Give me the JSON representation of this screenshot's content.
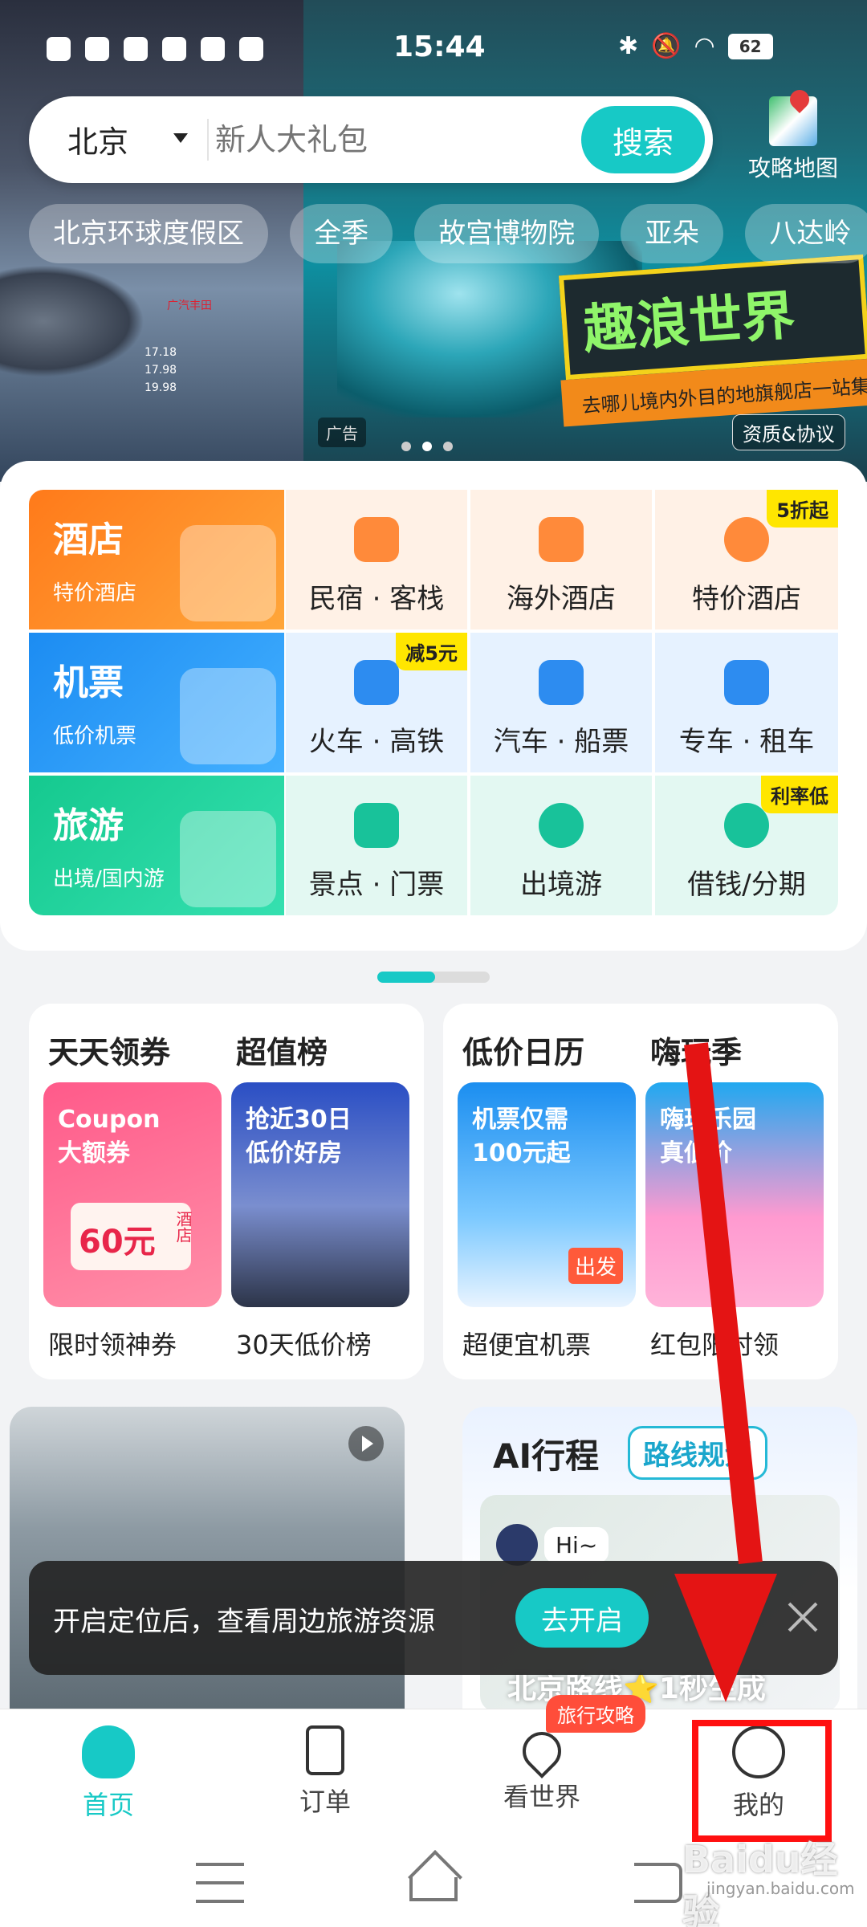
{
  "status_bar": {
    "time": "15:44",
    "battery": "62"
  },
  "search": {
    "city": "北京",
    "placeholder": "新人大礼包",
    "button": "搜索"
  },
  "map_shortcut": {
    "label": "攻略地图"
  },
  "hot_tags": [
    "北京环球度假区",
    "全季",
    "故宫博物院",
    "亚朵",
    "八达岭"
  ],
  "banner": {
    "car_brand": "广汽丰田",
    "car_prices": [
      "17.18",
      "17.98",
      "19.98"
    ],
    "promo_title": "趣浪世界",
    "promo_subtitle": "去哪儿境内外目的地旗舰店一站集",
    "ad_label": "广告",
    "qualification": "资质&协议"
  },
  "services": {
    "hotel": {
      "title": "酒店",
      "subtitle": "特价酒店"
    },
    "flight": {
      "title": "机票",
      "subtitle": "低价机票"
    },
    "travel": {
      "title": "旅游",
      "subtitle": "出境/国内游"
    },
    "row1": [
      {
        "label": "民宿 · 客栈"
      },
      {
        "label": "海外酒店"
      },
      {
        "label": "特价酒店",
        "badge": "5折起"
      }
    ],
    "row2": [
      {
        "label": "火车 · 高铁",
        "badge": "减5元"
      },
      {
        "label": "汽车 · 船票"
      },
      {
        "label": "专车 · 租车"
      }
    ],
    "row3": [
      {
        "label": "景点 · 门票"
      },
      {
        "label": "出境游"
      },
      {
        "label": "借钱/分期",
        "badge": "利率低"
      }
    ]
  },
  "promo_left": {
    "heading1": "天天领券",
    "heading2": "超值榜",
    "tile1": {
      "line1": "Coupon",
      "line2": "大额券",
      "amount": "60元",
      "tag": "酒店"
    },
    "tile2": {
      "line1": "抢近30日",
      "line2": "低价好房"
    },
    "caption1": "限时领神券",
    "caption2": "30天低价榜"
  },
  "promo_right": {
    "heading1": "低价日历",
    "heading2": "嗨玩季",
    "tile1": {
      "line1": "机票仅需",
      "line2": "100元起",
      "tag": "出发"
    },
    "tile2": {
      "line1": "嗨玩乐园",
      "line2": "真低价"
    },
    "caption1": "超便宜机票",
    "caption2": "红包限时领"
  },
  "ai_trip": {
    "title": "AI行程",
    "tag": "路线规划",
    "greeting": "Hi~",
    "footer": "北京路线⭐1秒生成"
  },
  "toast": {
    "text": "开启定位后，查看周边旅游资源",
    "button": "去开启"
  },
  "tabs": [
    {
      "label": "首页",
      "icon": "home-icon"
    },
    {
      "label": "订单",
      "icon": "order-icon"
    },
    {
      "label": "看世界",
      "icon": "location-icon",
      "badge": "旅行攻略"
    },
    {
      "label": "我的",
      "icon": "profile-icon"
    }
  ],
  "watermark": {
    "text": "Baidu经验",
    "sub": "jingyan.baidu.com"
  },
  "colors": {
    "accent": "#17c9c6",
    "annotation": "#e41414"
  }
}
